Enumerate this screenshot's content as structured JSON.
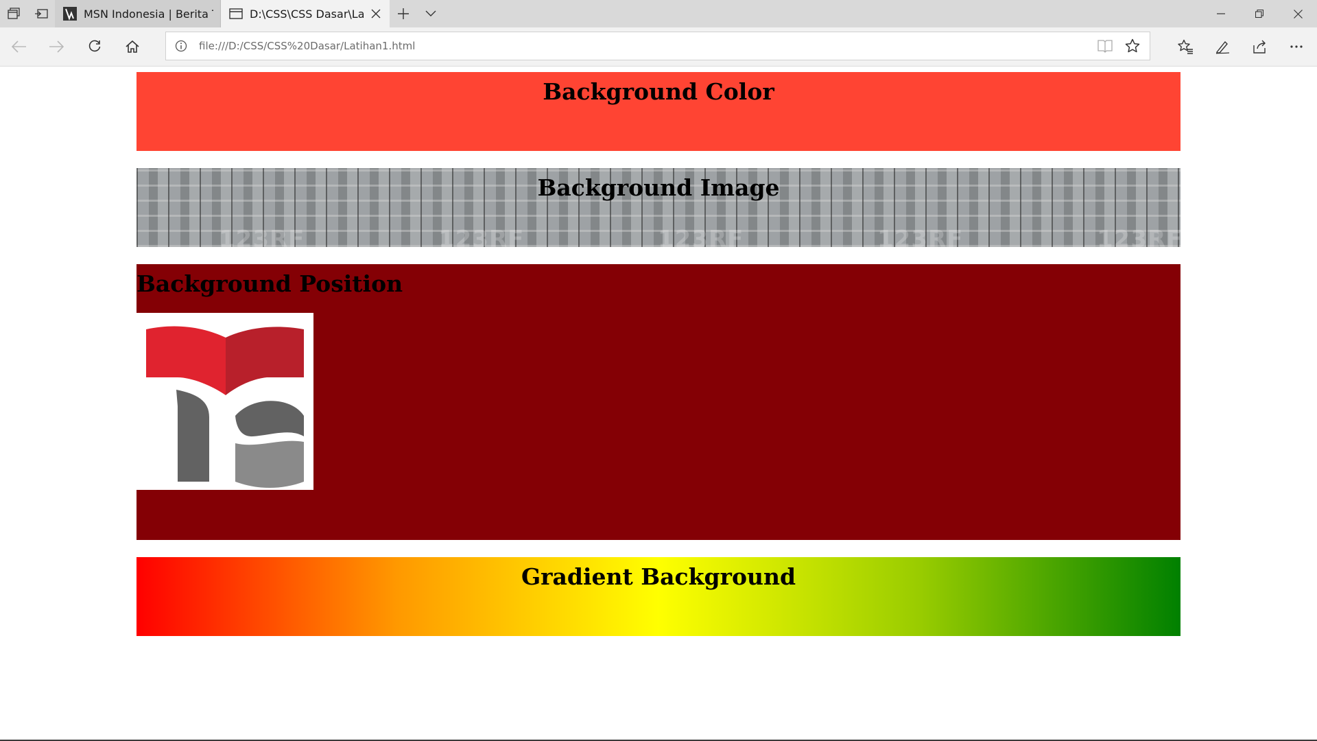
{
  "browser": {
    "tabs": [
      {
        "title": "MSN Indonesia | Berita Terk",
        "icon": "msn-icon",
        "active": false
      },
      {
        "title": "D:\\CSS\\CSS Dasar\\Latih",
        "icon": "page-icon",
        "active": true
      }
    ],
    "address": {
      "url": "file:///D:/CSS/CSS%20Dasar/Latihan1.html"
    },
    "icons": {
      "tab_actions": "tab-actions-icon",
      "set_aside": "set-aside-tabs-icon",
      "close_tab": "close-icon",
      "new_tab": "plus-icon",
      "tab_menu": "chevron-down-icon",
      "minimize": "minimize-icon",
      "restore": "restore-icon",
      "close_window": "close-window-icon",
      "back": "back-arrow-icon",
      "forward": "forward-arrow-icon",
      "refresh": "refresh-icon",
      "home": "home-icon",
      "info": "info-icon",
      "reading_view": "reading-view-icon",
      "favorite": "star-icon",
      "favorites_hub": "favorites-list-icon",
      "notes": "pen-icon",
      "share": "share-icon",
      "more": "more-icon"
    }
  },
  "page": {
    "sections": [
      {
        "heading": "Background Color",
        "color": "#ff4433"
      },
      {
        "heading": "Background Image",
        "watermark": "123RF"
      },
      {
        "heading": "Background Position",
        "color": "#840005"
      },
      {
        "heading": "Gradient Background",
        "colors": [
          "#ff0000",
          "#ffff00",
          "#008000"
        ]
      }
    ]
  }
}
